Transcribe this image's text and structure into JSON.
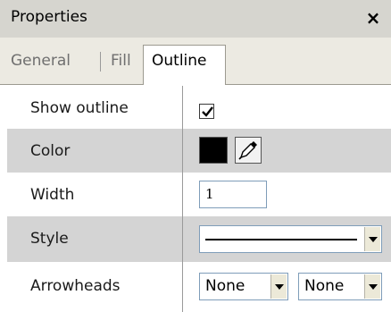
{
  "window": {
    "title": "Properties",
    "close_glyph": "×"
  },
  "tabs": [
    {
      "label": "General",
      "active": false
    },
    {
      "label": "Fill",
      "active": false
    },
    {
      "label": "Outline",
      "active": true
    }
  ],
  "properties": {
    "show_outline": {
      "label": "Show outline",
      "checked": true
    },
    "color": {
      "label": "Color",
      "value": "#000000",
      "picker_icon": "eyedropper-icon"
    },
    "width": {
      "label": "Width",
      "value": "1"
    },
    "style": {
      "label": "Style",
      "value_icon": "solid-line"
    },
    "arrowheads": {
      "label": "Arrowheads",
      "start": "None",
      "end": "None"
    }
  }
}
